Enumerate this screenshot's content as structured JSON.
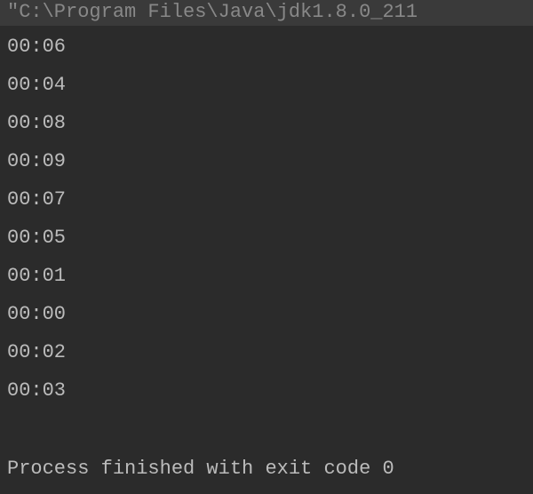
{
  "command_line": "\"C:\\Program Files\\Java\\jdk1.8.0_211",
  "output_lines": [
    "00:06",
    "00:04",
    "00:08",
    "00:09",
    "00:07",
    "00:05",
    "00:01",
    "00:00",
    "00:02",
    "00:03"
  ],
  "status_message": "Process finished with exit code 0"
}
